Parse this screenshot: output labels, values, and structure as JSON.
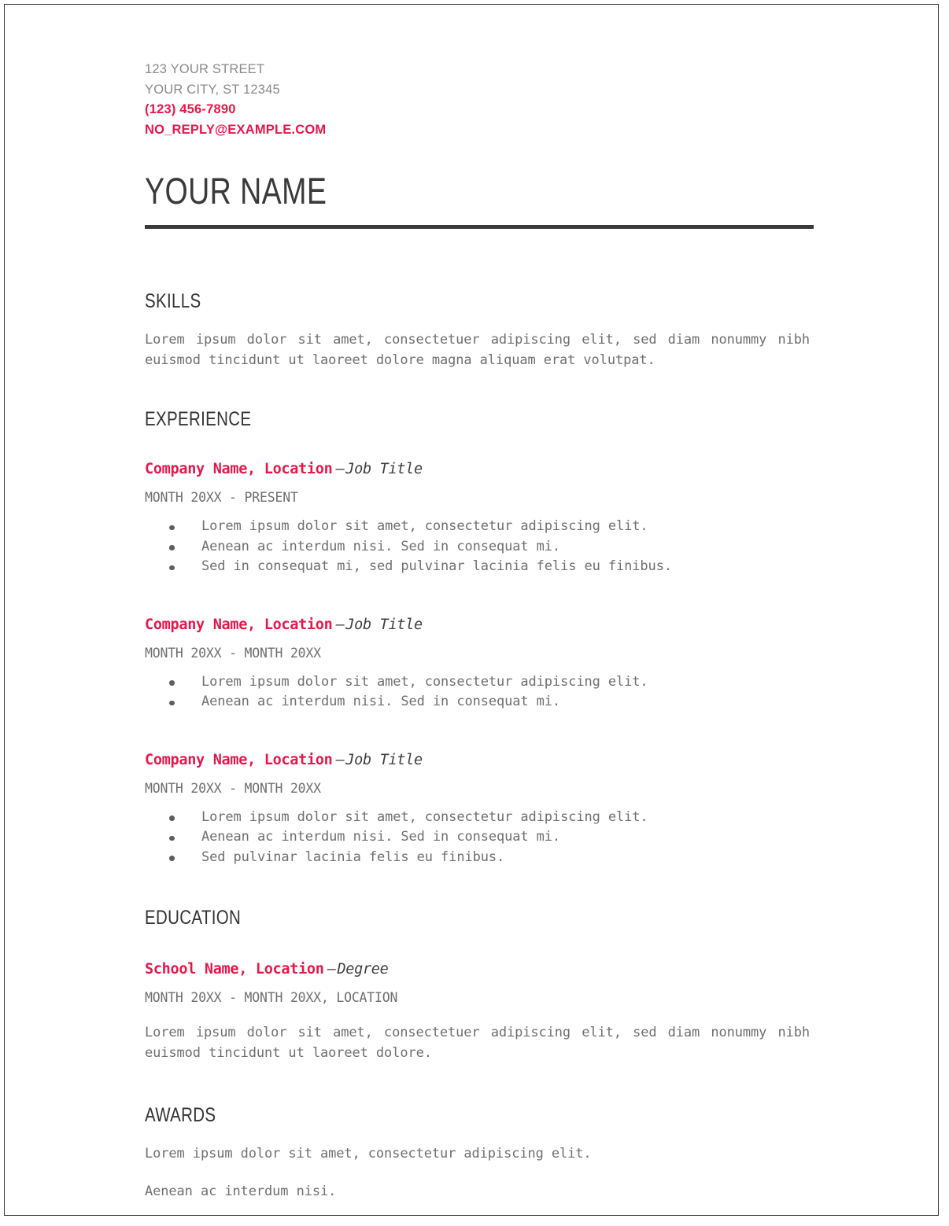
{
  "document": {
    "type": "resume",
    "accent_color": "#E8174B",
    "text_color": "#6F6F6F",
    "heading_color": "#333333"
  },
  "header": {
    "street": "123 YOUR STREET",
    "city_state_zip": "YOUR CITY, ST 12345",
    "phone": "(123) 456-7890",
    "email": "NO_REPLY@EXAMPLE.COM",
    "name": "YOUR NAME"
  },
  "skills": {
    "heading": "SKILLS",
    "body": "Lorem ipsum dolor sit amet, consectetuer adipiscing elit, sed diam nonummy nibh euismod tincidunt ut laoreet dolore magna aliquam erat volutpat."
  },
  "experience": {
    "heading": "EXPERIENCE",
    "entries": [
      {
        "organization": "Company Name, Location",
        "separator": "–",
        "title": "Job Title",
        "dates": "MONTH 20XX - PRESENT",
        "bullets": [
          "Lorem ipsum dolor sit amet, consectetur adipiscing elit.",
          "Aenean ac interdum nisi. Sed in consequat mi.",
          "Sed in consequat mi, sed pulvinar lacinia felis eu finibus."
        ]
      },
      {
        "organization": "Company Name, Location",
        "separator": "–",
        "title": "Job Title",
        "dates": "MONTH 20XX - MONTH 20XX",
        "bullets": [
          "Lorem ipsum dolor sit amet, consectetur adipiscing elit.",
          "Aenean ac interdum nisi. Sed in consequat mi."
        ]
      },
      {
        "organization": "Company Name, Location",
        "separator": "–",
        "title": "Job Title",
        "dates": "MONTH 20XX - MONTH 20XX",
        "bullets": [
          "Lorem ipsum dolor sit amet, consectetur adipiscing elit.",
          "Aenean ac interdum nisi. Sed in consequat mi.",
          "Sed pulvinar lacinia felis eu finibus."
        ]
      }
    ]
  },
  "education": {
    "heading": "EDUCATION",
    "organization": "School Name, Location",
    "separator": "–",
    "title": "Degree",
    "dates": "MONTH 20XX - MONTH 20XX, LOCATION",
    "body": "Lorem ipsum dolor sit amet, consectetuer adipiscing elit, sed diam nonummy nibh euismod tincidunt ut laoreet dolore."
  },
  "awards": {
    "heading": "AWARDS",
    "lines": [
      "Lorem ipsum dolor sit amet, consectetur adipiscing elit.",
      "Aenean ac interdum nisi."
    ]
  }
}
